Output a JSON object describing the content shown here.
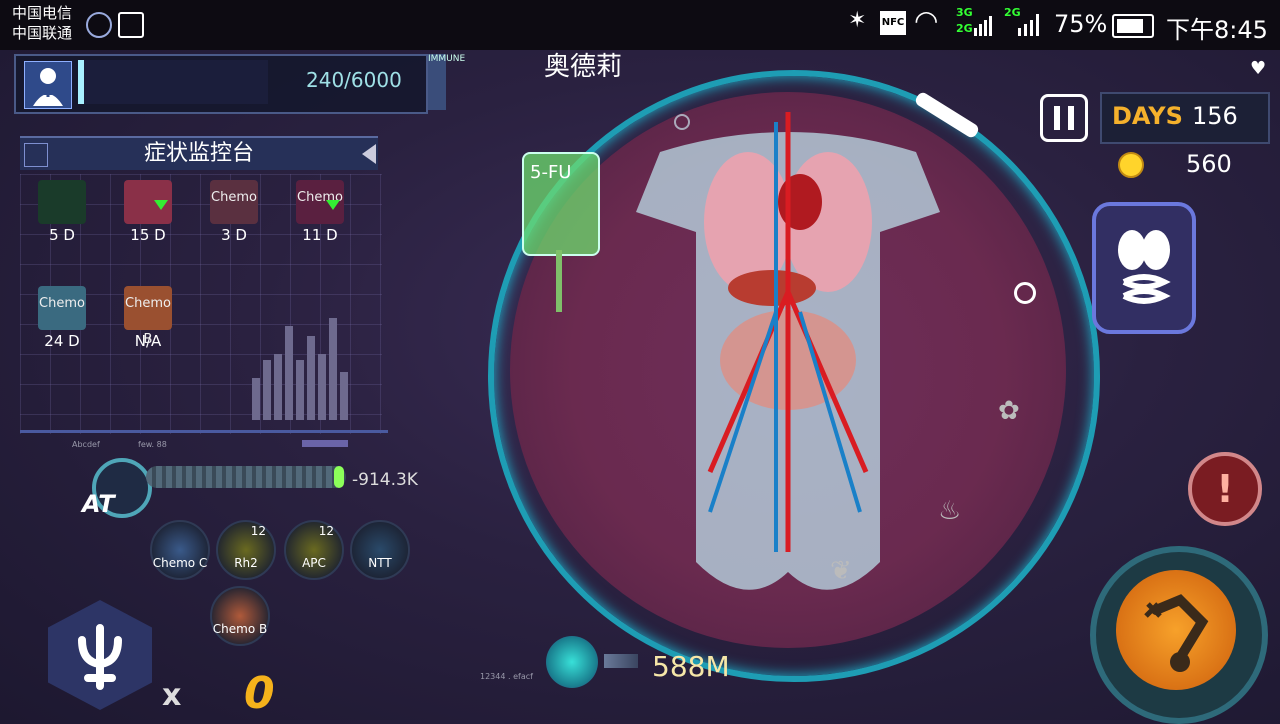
{
  "status_bar": {
    "carrier_1": "中国电信",
    "carrier_2": "中国联通",
    "network_3g": "3G",
    "network_2g_a": "2G",
    "network_2g_b": "2G",
    "battery": "75%",
    "time": "下午8:45"
  },
  "patient": {
    "immune_value": "240/6000",
    "immune_tag": "IMMUNE"
  },
  "body": {
    "label": "奥德莉",
    "iv_drug": "5-FU"
  },
  "monitor": {
    "title": "症状监控台",
    "symptoms": [
      {
        "icon_text": "",
        "duration": "5 D",
        "trend": "",
        "color": "#1a3b2a"
      },
      {
        "icon_text": "",
        "duration": "15 D",
        "trend": "down",
        "color": "#8a3048"
      },
      {
        "icon_text": "Chemo",
        "duration": "3 D",
        "trend": "",
        "color": "#5a3040"
      },
      {
        "icon_text": "Chemo",
        "duration": "11 D",
        "trend": "down",
        "color": "#5a2040"
      },
      {
        "icon_text": "Chemo",
        "duration": "24 D",
        "trend": "",
        "color": "#3a6a80"
      },
      {
        "icon_text": "Chemo B",
        "duration": "N/A",
        "trend": "",
        "color": "#9a5030"
      }
    ],
    "chart_footer_1": "Abcdef",
    "chart_footer_2": "few. 88",
    "bars": [
      0.35,
      0.5,
      0.55,
      0.78,
      0.5,
      0.7,
      0.55,
      0.85,
      0.4
    ]
  },
  "at": {
    "label": "AT",
    "value": "-914.3K"
  },
  "drugs": [
    {
      "name": "Chemo C",
      "level": ""
    },
    {
      "name": "Rh2",
      "level": "12"
    },
    {
      "name": "APC",
      "level": "12"
    },
    {
      "name": "NTT",
      "level": ""
    },
    {
      "name": "Chemo B",
      "level": ""
    }
  ],
  "combo": {
    "multiplier": "x",
    "count": "0"
  },
  "pathogen": {
    "count": "588M",
    "footer": "12344 . efacf"
  },
  "game": {
    "days_label": "DAYS",
    "days_value": "156",
    "coins": "560",
    "alert_symbol": "!"
  },
  "colors": {
    "accent_cyan": "#1e9db4",
    "gold": "#f5b12c",
    "orange": "#e07d1a"
  }
}
